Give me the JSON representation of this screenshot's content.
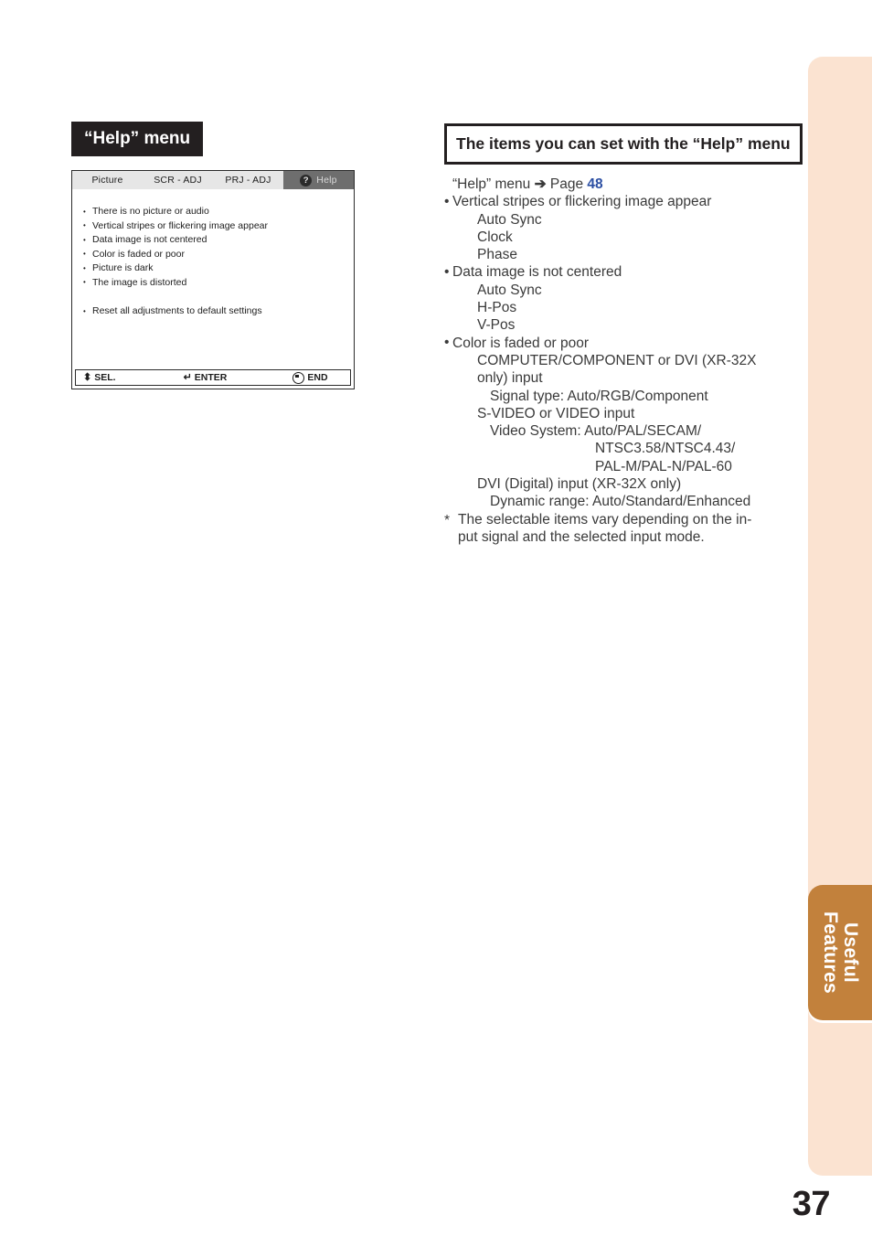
{
  "page": {
    "number": "37",
    "section_tab_label": "Useful\nFeatures",
    "accent_brown": "#c2813c",
    "accent_cream": "#fbe3d1",
    "link_blue": "#2c4fa3"
  },
  "left": {
    "heading": "“Help” menu",
    "osd": {
      "tabs": [
        {
          "label": "Picture",
          "active": false
        },
        {
          "label": "SCR - ADJ",
          "active": false
        },
        {
          "label": "PRJ - ADJ",
          "active": false
        },
        {
          "label": "Help",
          "active": true,
          "icon": "question-mark-icon",
          "icon_glyph": "?"
        }
      ],
      "items_group_1": [
        "There is no picture or audio",
        "Vertical stripes or flickering image appear",
        "Data image is not centered",
        "Color is faded or poor",
        "Picture is dark",
        "The image is distorted"
      ],
      "items_group_2": [
        "Reset all adjustments to default settings"
      ],
      "footer": {
        "sel_glyph": "⬍",
        "sel_label": "SEL.",
        "enter_glyph": "↵",
        "enter_label": "ENTER",
        "end_label": "END"
      }
    }
  },
  "right": {
    "heading": "The items you can set with the “Help” menu",
    "reference": {
      "prefix": "“Help” menu",
      "arrow": "➔",
      "page_word": "Page",
      "page_num": "48"
    },
    "lines": [
      {
        "text": "Vertical stripes or flickering image appear",
        "style": "bullet"
      },
      {
        "text": "Auto Sync",
        "style": "ind1"
      },
      {
        "text": "Clock",
        "style": "ind1"
      },
      {
        "text": "Phase",
        "style": "ind1"
      },
      {
        "text": "Data image is not centered",
        "style": "bullet"
      },
      {
        "text": "Auto Sync",
        "style": "ind1"
      },
      {
        "text": "H-Pos",
        "style": "ind1"
      },
      {
        "text": "V-Pos",
        "style": "ind1"
      },
      {
        "text": "Color is faded or poor",
        "style": "bullet"
      },
      {
        "text": "COMPUTER/COMPONENT or DVI (XR-32X",
        "style": "ind1"
      },
      {
        "text": "only) input",
        "style": "ind1"
      },
      {
        "text": "Signal type: Auto/RGB/Component",
        "style": "ind2"
      },
      {
        "text": "S-VIDEO or VIDEO input",
        "style": "ind1"
      },
      {
        "text": "Video System: Auto/PAL/SECAM/",
        "style": "ind2"
      },
      {
        "text": "NTSC3.58/NTSC4.43/",
        "style": "ind3"
      },
      {
        "text": "PAL-M/PAL-N/PAL-60",
        "style": "ind3"
      },
      {
        "text": "DVI (Digital) input (XR-32X only)",
        "style": "ind1"
      },
      {
        "text": "Dynamic range: Auto/Standard/Enhanced",
        "style": "ind2"
      },
      {
        "text": "The selectable items vary depending on the in-",
        "style": "note"
      },
      {
        "text": "put signal and the selected input mode.",
        "style": "note-cont"
      }
    ]
  }
}
